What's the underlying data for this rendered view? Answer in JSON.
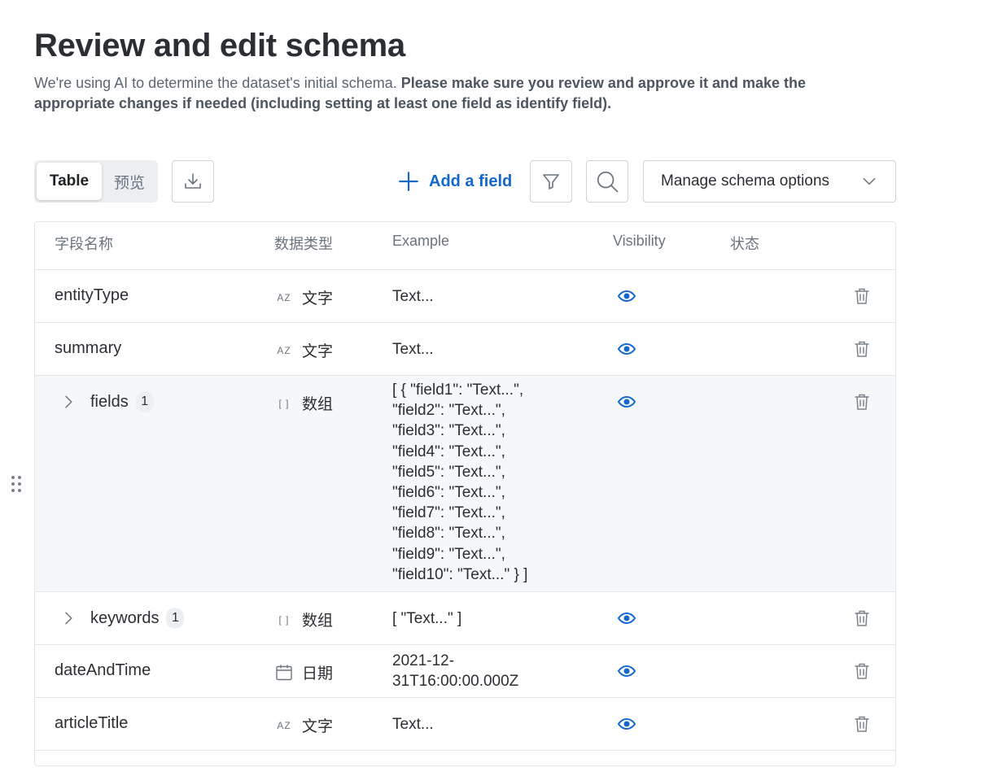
{
  "header": {
    "title": "Review and edit schema",
    "description_plain": "We're using AI to determine the dataset's initial schema. ",
    "description_bold": "Please make sure you review and approve it and make the appropriate changes if needed (including setting at least one field as identify field)."
  },
  "toolbar": {
    "view_table": "Table",
    "view_preview": "预览",
    "add_field": "Add a field",
    "manage_schema": "Manage schema options"
  },
  "table": {
    "columns": {
      "field_name": "字段名称",
      "data_type": "数据类型",
      "example": "Example",
      "visibility": "Visibility",
      "status": "状态"
    },
    "rows": [
      {
        "name": "entityType",
        "type_icon": "az-text-icon",
        "type_icon_text": "AZ",
        "type": "文字",
        "example": "Text..."
      },
      {
        "name": "summary",
        "type_icon": "az-text-icon",
        "type_icon_text": "AZ",
        "type": "文字",
        "example": "Text..."
      },
      {
        "name": "fields",
        "count": "1",
        "type_icon": "array-icon",
        "type_icon_text": "[ ]",
        "type": "数组",
        "example_lines": [
          "[ { \"field1\": \"Text...\",",
          "\"field2\": \"Text...\",",
          "\"field3\": \"Text...\",",
          "\"field4\": \"Text...\",",
          "\"field5\": \"Text...\",",
          "\"field6\": \"Text...\",",
          "\"field7\": \"Text...\",",
          "\"field8\": \"Text...\",",
          "\"field9\": \"Text...\",",
          "\"field10\": \"Text...\" } ]"
        ]
      },
      {
        "name": "keywords",
        "count": "1",
        "type_icon": "array-icon",
        "type_icon_text": "[ ]",
        "type": "数组",
        "example": "[ \"Text...\" ]"
      },
      {
        "name": "dateAndTime",
        "type_icon": "calendar-icon",
        "type": "日期",
        "example_lines": [
          "2021-12-",
          "31T16:00:00.000Z"
        ]
      },
      {
        "name": "articleTitle",
        "type_icon": "az-text-icon",
        "type_icon_text": "AZ",
        "type": "文字",
        "example": "Text..."
      }
    ]
  },
  "colors": {
    "accent": "#1368ce",
    "text": "#2b2f33",
    "muted": "#6b747d",
    "border": "#e3e7ea",
    "row_highlight": "#f5f7f9"
  }
}
